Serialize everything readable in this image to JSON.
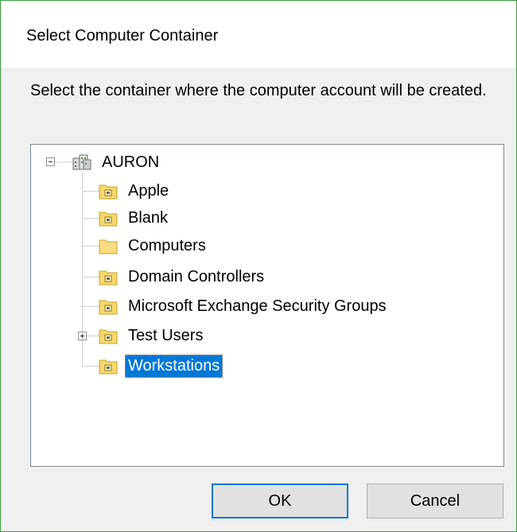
{
  "dialog": {
    "title": "Select Computer Container",
    "prompt": "Select the container where the computer account will be created."
  },
  "tree": {
    "root": {
      "label": "AURON",
      "icon": "domain-icon",
      "expanded": true
    },
    "children": [
      {
        "label": "Apple",
        "icon": "ou-folder-icon",
        "expandable": false,
        "selected": false
      },
      {
        "label": "Blank",
        "icon": "ou-folder-icon",
        "expandable": false,
        "selected": false
      },
      {
        "label": "Computers",
        "icon": "container-folder-icon",
        "expandable": false,
        "selected": false
      },
      {
        "label": "Domain Controllers",
        "icon": "ou-folder-icon",
        "expandable": false,
        "selected": false
      },
      {
        "label": "Microsoft Exchange Security Groups",
        "icon": "ou-folder-icon",
        "expandable": false,
        "selected": false
      },
      {
        "label": "Test Users",
        "icon": "ou-folder-icon",
        "expandable": true,
        "selected": false
      },
      {
        "label": "Workstations",
        "icon": "ou-folder-icon",
        "expandable": false,
        "selected": true
      }
    ]
  },
  "buttons": {
    "ok_label": "OK",
    "cancel_label": "Cancel"
  },
  "colors": {
    "selection": "#0078d7",
    "folder": "#f5d76e",
    "window_border": "#3c9a3c"
  }
}
